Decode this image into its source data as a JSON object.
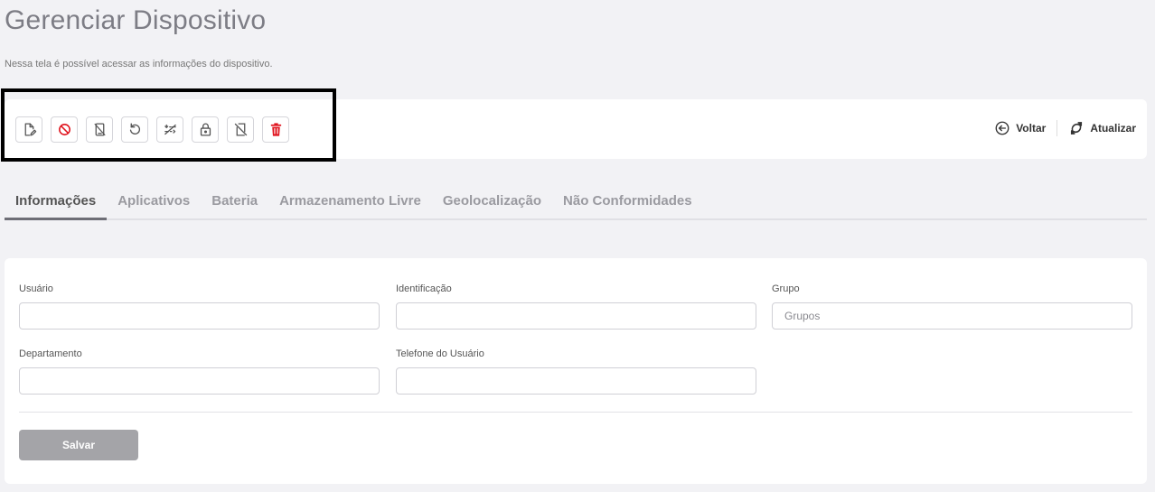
{
  "header": {
    "title": "Gerenciar Dispositivo",
    "subtitle": "Nessa tela é possível acessar as informações do dispositivo."
  },
  "toolbar": {
    "icons": [
      {
        "name": "edit-document-icon",
        "color": "#555555"
      },
      {
        "name": "block-icon",
        "color": "#e0141e"
      },
      {
        "name": "wipe-device-icon",
        "color": "#555555"
      },
      {
        "name": "restart-icon",
        "color": "#555555"
      },
      {
        "name": "password-reset-icon",
        "color": "#555555"
      },
      {
        "name": "lock-icon",
        "color": "#555555"
      },
      {
        "name": "device-disabled-icon",
        "color": "#555555"
      },
      {
        "name": "trash-icon",
        "color": "#e0141e"
      }
    ],
    "back_label": "Voltar",
    "refresh_label": "Atualizar"
  },
  "tabs": [
    {
      "label": "Informações",
      "active": true
    },
    {
      "label": "Aplicativos",
      "active": false
    },
    {
      "label": "Bateria",
      "active": false
    },
    {
      "label": "Armazenamento Livre",
      "active": false
    },
    {
      "label": "Geolocalização",
      "active": false
    },
    {
      "label": "Não Conformidades",
      "active": false
    }
  ],
  "form": {
    "usuario": {
      "label": "Usuário",
      "value": "",
      "placeholder": ""
    },
    "identificacao": {
      "label": "Identificação",
      "value": "",
      "placeholder": ""
    },
    "grupo": {
      "label": "Grupo",
      "value": "",
      "placeholder": "Grupos"
    },
    "departamento": {
      "label": "Departamento",
      "value": "",
      "placeholder": ""
    },
    "telefone": {
      "label": "Telefone do Usuário",
      "value": "",
      "placeholder": ""
    },
    "save_label": "Salvar"
  }
}
